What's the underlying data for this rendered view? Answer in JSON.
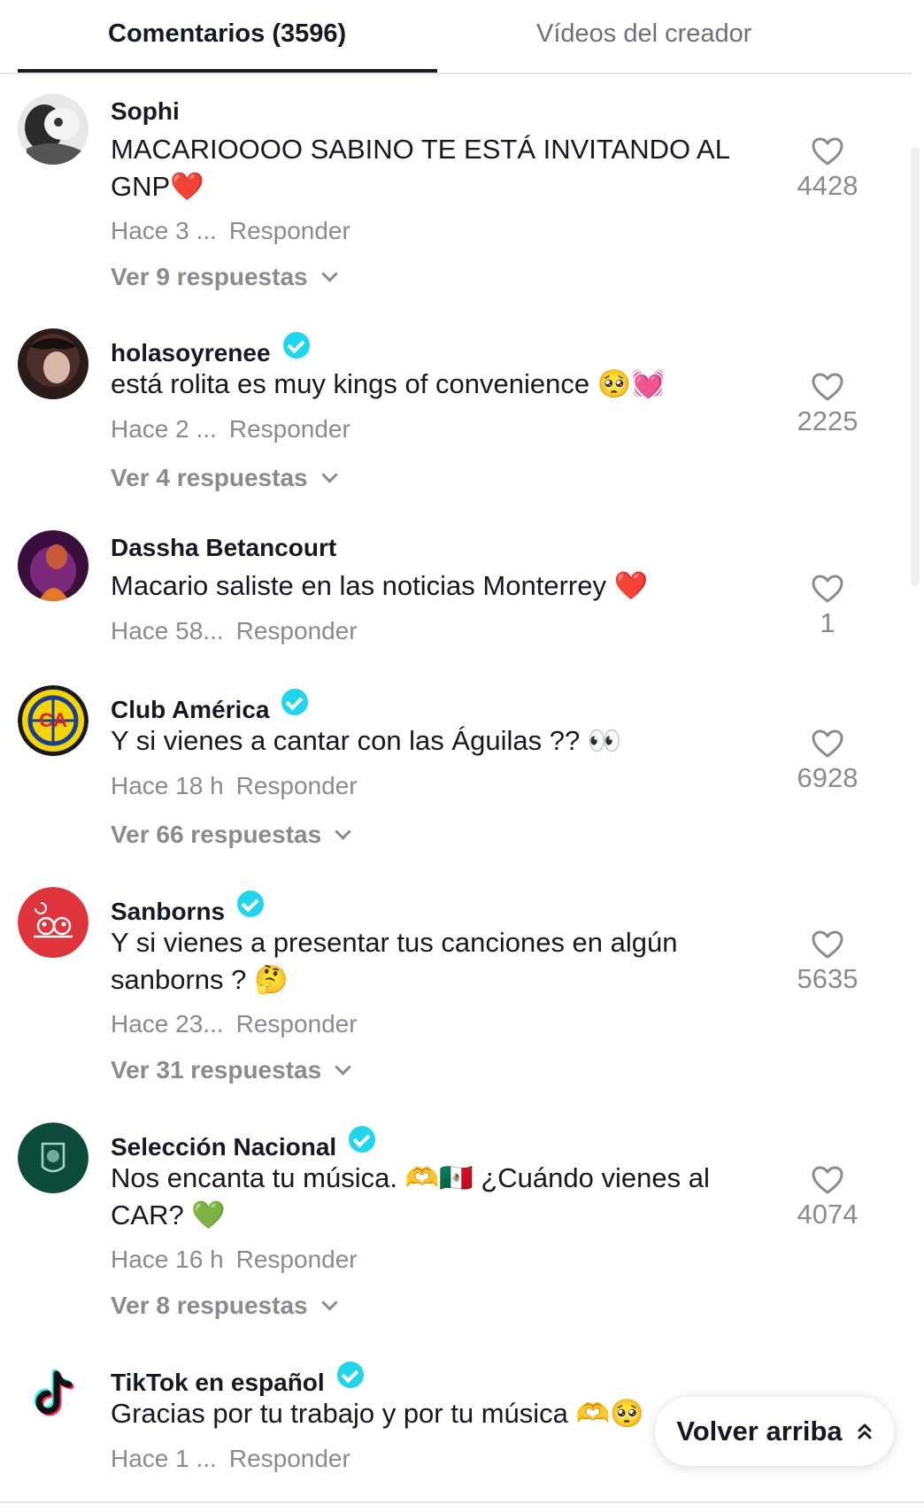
{
  "tabs": {
    "comments_label": "Comentarios (3596)",
    "creator_videos_label": "Vídeos del creador"
  },
  "reply_label": "Responder",
  "comments": [
    {
      "author": "Sophi",
      "verified": false,
      "text": "MACARIOOOO SABINO TE ESTÁ INVITANDO AL GNP❤️",
      "time": "Hace 3 ...",
      "replies": "Ver 9 respuestas",
      "likes": "4428"
    },
    {
      "author": "holasoyrenee",
      "verified": true,
      "text": "está rolita es muy kings of convenience 🥺💓",
      "time": "Hace 2 ...",
      "replies": "Ver 4 respuestas",
      "likes": "2225"
    },
    {
      "author": "Dassha Betancourt",
      "verified": false,
      "text": "Macario saliste en las noticias Monterrey ❤️",
      "time": "Hace 58...",
      "replies": "",
      "likes": "1"
    },
    {
      "author": "Club América",
      "verified": true,
      "text": "Y si vienes a cantar con las Águilas ?? 👀",
      "time": "Hace 18 h",
      "replies": "Ver 66 respuestas",
      "likes": "6928"
    },
    {
      "author": "Sanborns",
      "verified": true,
      "text": "Y si vienes a presentar tus canciones en algún sanborns ? 🤔",
      "time": "Hace 23...",
      "replies": "Ver 31 respuestas",
      "likes": "5635"
    },
    {
      "author": "Selección Nacional",
      "verified": true,
      "text": "Nos encanta tu música. 🫶🇲🇽 ¿Cuándo vienes al CAR? 💚",
      "time": "Hace 16 h",
      "replies": "Ver 8 respuestas",
      "likes": "4074"
    },
    {
      "author": "TikTok en español",
      "verified": true,
      "text": "Gracias por tu trabajo y por tu música 🫶🥺",
      "time": "Hace 1 ...",
      "replies": "",
      "likes": ""
    }
  ],
  "back_to_top_label": "Volver arriba",
  "colors": {
    "text_primary": "#161823",
    "text_secondary": "#8a8b91",
    "verified": "#20d5ec",
    "sanborns_red": "#e0343c",
    "seleccion_green": "#0d4a3c"
  }
}
